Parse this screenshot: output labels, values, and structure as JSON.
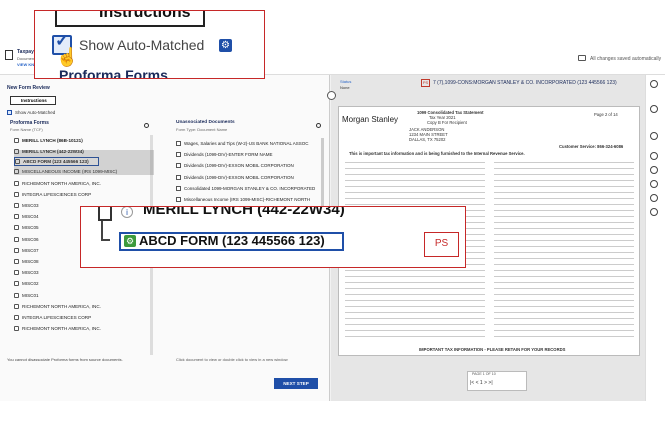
{
  "app": {
    "taxpayer_label": "Taxpayer",
    "doc_sub": "Document",
    "view_link": "VIEW KN",
    "saved_status": "All changes saved automatically"
  },
  "left": {
    "title": "New Form Review",
    "instructions": "Instructions",
    "show_auto_matched": "Show Auto-Matched",
    "proforma_title": "Proforma Forms",
    "form_name_label": "Form Name (TCF)",
    "tree": [
      {
        "label": "MERILL LYNCH (86B-10121)",
        "bold": true
      },
      {
        "label": "MERILL LYNCH (442-22W34)",
        "bold": true
      },
      {
        "label": "ABCD FORM (123 445566 123)",
        "bold": true,
        "selected": true
      },
      {
        "label": "MISCELLANEOUS INCOME (IRS 1099-MISC)",
        "bold": false
      },
      {
        "label": "RICHEMONT NORTH AMERICA, INC.",
        "bold": false
      },
      {
        "label": "INTEGRA LIFESCIENCES CORP",
        "bold": false
      },
      {
        "label": "MISC03",
        "bold": false
      },
      {
        "label": "MISC04",
        "bold": false
      },
      {
        "label": "MISC05",
        "bold": false
      },
      {
        "label": "MISC06",
        "bold": false
      },
      {
        "label": "MISC07",
        "bold": false
      },
      {
        "label": "MISC08",
        "bold": false
      },
      {
        "label": "MISC03",
        "bold": false
      },
      {
        "label": "MISC02",
        "bold": false
      },
      {
        "label": "MISC01",
        "bold": false
      },
      {
        "label": "RICHEMONT NORTH AMERICA, INC.",
        "bold": false
      },
      {
        "label": "INTEGRA LIFESCIENCES CORP",
        "bold": false
      },
      {
        "label": "RICHEMONT NORTH AMERICA, INC.",
        "bold": false
      }
    ],
    "footer": "You cannot disassociate Proforma forms from source documents."
  },
  "middle": {
    "title": "Unassociated Documents",
    "sub": "Form Type: Document Name",
    "docs": [
      "Wages, Salaries and Tips (W-2)-US BANK NATIONAL ASSOC",
      "Dividends (1099-DIV)-ENTER FORM NAME",
      "Dividends (1099-DIV)-EXXON MOBIL CORPORATION",
      "Dividends (1099-DIV)-EXXON MOBIL CORPORATION",
      "Consolidated 1099-MORGAN STANLEY & CO. INCORPORATED",
      "Miscellaneous Income (IRS 1099-MISC)-RICHEMONT NORTH"
    ],
    "footer": "Click document to view or double click to view in a new window",
    "next_button": "NEXT STEP"
  },
  "viewer": {
    "status_label": "Status",
    "status_value": "None",
    "ps_small": "PS",
    "doc_title": "7 (7),1099-CONS:MORGAN STANLEY & CO. INCORPORATED (123 445566 123)",
    "brand": "Morgan Stanley",
    "statement_title": "1099 Consolidated Tax Statement",
    "tax_year": "Tax Year 2021",
    "copy_b": "Copy B For Recipient",
    "recipient_name": "JACK ANDERSON",
    "recipient_street": "1234 MAIN STREET",
    "recipient_city": "DALLAS, TX 75202",
    "page_label": "Page 2 of 14",
    "customer_service": "Customer Service: 866-324-6086",
    "notice": "This is important tax information and is being furnished to the Internal Revenue Service.",
    "footer_note": "IMPORTANT TAX INFORMATION - PLEASE RETAIN FOR YOUR RECORDS",
    "pager_label": "PAGE 1 OF 10",
    "pager_controls": "|< < 1 > >|"
  },
  "callout_top": {
    "instructions": "Instructions",
    "show_auto_matched": "Show Auto-Matched",
    "proforma": "Proforma Forms"
  },
  "callout_bottom": {
    "parent": "MERILL LYNCH (442-22W34)",
    "selected": "ABCD FORM (123 445566 123)",
    "ps_badge": "PS"
  }
}
